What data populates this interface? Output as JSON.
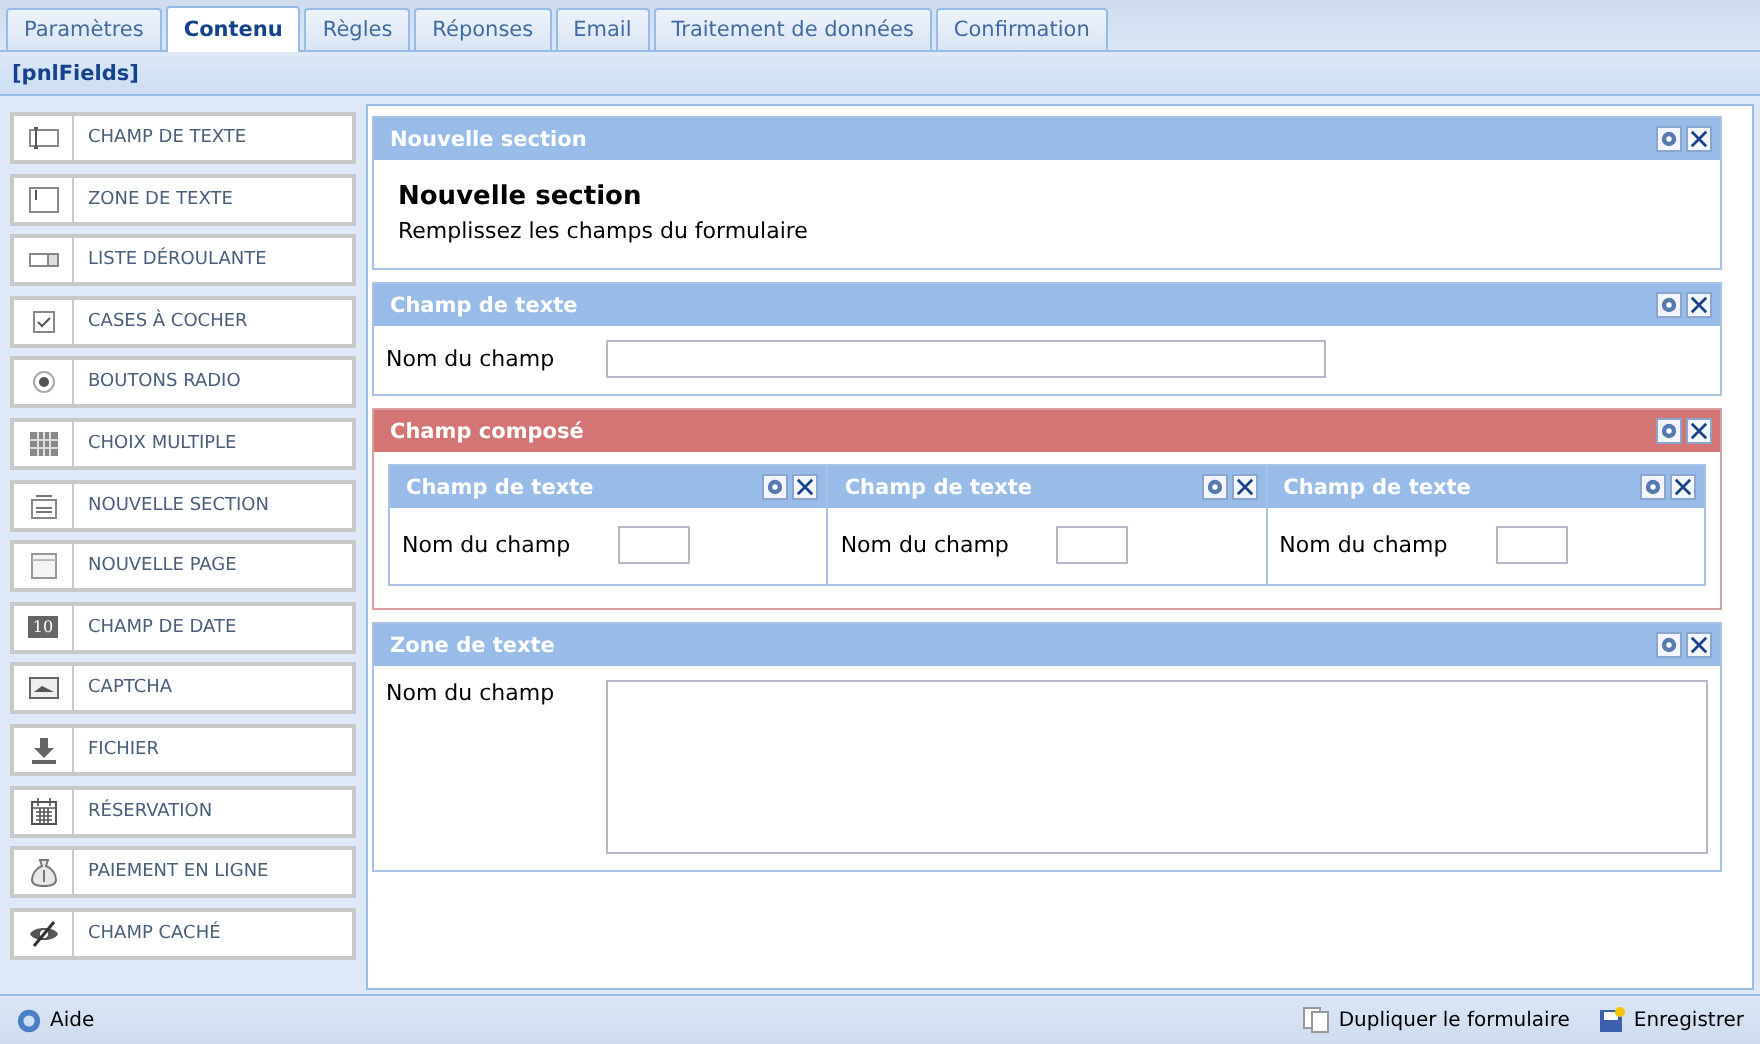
{
  "tabs": [
    {
      "label": "Paramètres",
      "selected": false
    },
    {
      "label": "Contenu",
      "selected": true
    },
    {
      "label": "Règles",
      "selected": false
    },
    {
      "label": "Réponses",
      "selected": false
    },
    {
      "label": "Email",
      "selected": false
    },
    {
      "label": "Traitement de données",
      "selected": false
    },
    {
      "label": "Confirmation",
      "selected": false
    }
  ],
  "panel_title": "[pnlFields]",
  "palette": [
    {
      "label": "CHAMP DE TEXTE",
      "kind": "textfield"
    },
    {
      "label": "ZONE DE TEXTE",
      "kind": "textarea"
    },
    {
      "label": "LISTE DÉROULANTE",
      "kind": "dropdown"
    },
    {
      "label": "CASES À COCHER",
      "kind": "checkbox"
    },
    {
      "label": "BOUTONS RADIO",
      "kind": "radio"
    },
    {
      "label": "CHOIX MULTIPLE",
      "kind": "grid"
    },
    {
      "label": "NOUVELLE SECTION",
      "kind": "section"
    },
    {
      "label": "NOUVELLE PAGE",
      "kind": "page"
    },
    {
      "label": "CHAMP DE DATE",
      "kind": "date",
      "icon_text": "10"
    },
    {
      "label": "CAPTCHA",
      "kind": "captcha"
    },
    {
      "label": "FICHIER",
      "kind": "file"
    },
    {
      "label": "RÉSERVATION",
      "kind": "calendar"
    },
    {
      "label": "PAIEMENT EN LIGNE",
      "kind": "money"
    },
    {
      "label": "CHAMP CACHÉ",
      "kind": "hidden"
    }
  ],
  "blocks": [
    {
      "kind": "section",
      "title": "Nouvelle section",
      "heading": "Nouvelle section",
      "description": "Remplissez les champs du formulaire"
    },
    {
      "kind": "textfield",
      "title": "Champ de texte",
      "label": "Nom du champ"
    },
    {
      "kind": "composite",
      "title": "Champ composé",
      "children": [
        {
          "title": "Champ de texte",
          "label": "Nom du champ"
        },
        {
          "title": "Champ de texte",
          "label": "Nom du champ"
        },
        {
          "title": "Champ de texte",
          "label": "Nom du champ"
        }
      ]
    },
    {
      "kind": "textarea",
      "title": "Zone de texte",
      "label": "Nom du champ"
    }
  ],
  "footer": {
    "help": "Aide",
    "actions": [
      {
        "label": "Dupliquer le formulaire",
        "kind": "duplicate"
      },
      {
        "label": "Enregistrer",
        "kind": "save"
      }
    ]
  }
}
